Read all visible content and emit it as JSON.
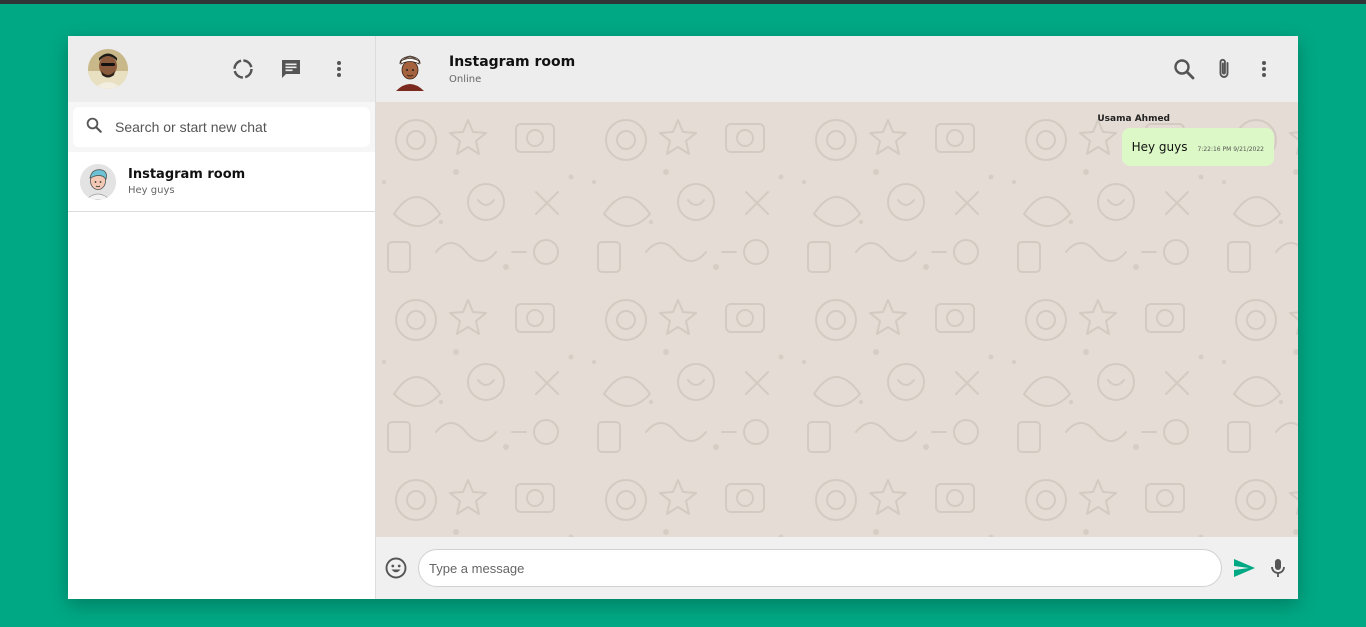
{
  "sidebar": {
    "user_avatar_alt": "user-avatar",
    "search": {
      "placeholder": "Search or start new chat"
    },
    "chats": [
      {
        "name": "Instagram room",
        "last_message": "Hey guys"
      }
    ]
  },
  "room": {
    "name": "Instagram room",
    "status": "Online"
  },
  "messages": [
    {
      "sender": "Usama Ahmed",
      "text": "Hey guys",
      "time": "7:22:16 PM 9/21/2022"
    }
  ],
  "composer": {
    "placeholder": "Type a message"
  },
  "colors": {
    "brand": "#00a884",
    "header_bg": "#ededed",
    "chat_bg": "#e5ddd5",
    "outgoing_bubble": "#dcf8c6",
    "send_icon": "#00a884",
    "icon_gray": "#555555"
  },
  "icons": {
    "status": "status-icon",
    "new_chat": "new-chat-icon",
    "menu": "more-vert-icon",
    "search": "search-icon",
    "attach": "paperclip-icon",
    "emoji": "emoji-icon",
    "send": "send-icon",
    "mic": "mic-icon"
  }
}
